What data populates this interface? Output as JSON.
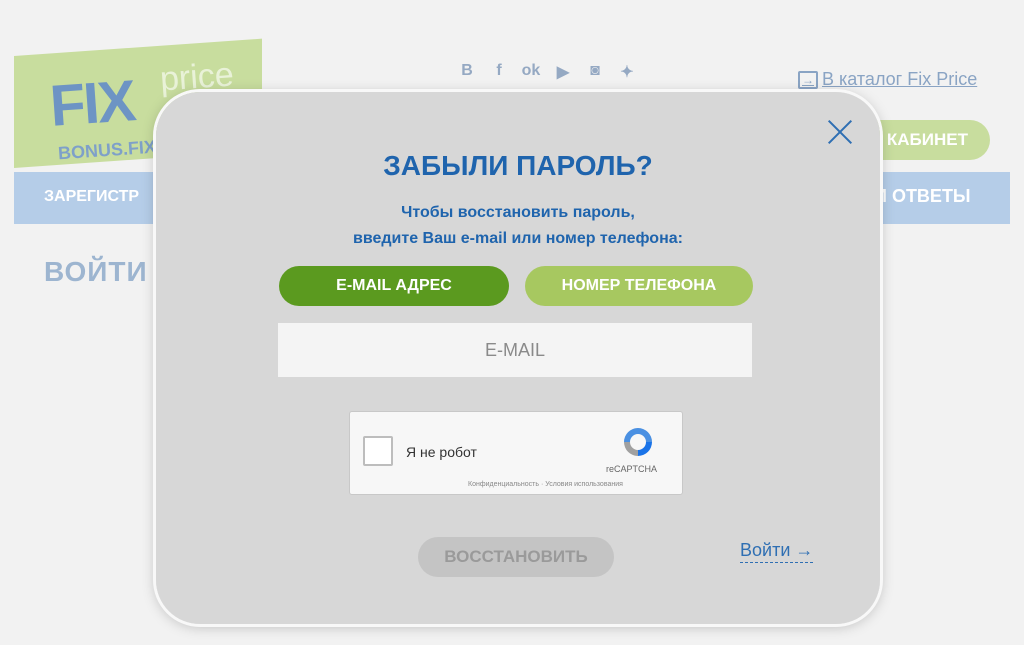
{
  "background": {
    "logo": {
      "main": "FIX",
      "secondary": "price",
      "sub": "BONUS.FIX"
    },
    "socials": [
      {
        "label": "В",
        "icon": "vk-icon"
      },
      {
        "label": "f",
        "icon": "facebook-icon"
      },
      {
        "label": "ok",
        "icon": "odnoklassniki-icon"
      },
      {
        "label": "▶",
        "icon": "youtube-icon"
      },
      {
        "label": "◙",
        "icon": "instagram-icon"
      },
      {
        "label": "✦",
        "icon": "twitter-icon"
      }
    ],
    "catalog_link": "В каталог Fix Price",
    "cabinet_button": "КАБИНЕТ",
    "nav_left": "ЗАРЕГИСТР",
    "nav_right": "И ОТВЕТЫ",
    "login_heading": "ВОЙТИ"
  },
  "modal": {
    "title": "ЗАБЫЛИ ПАРОЛЬ?",
    "subtitle_line1": "Чтобы восстановить пароль,",
    "subtitle_line2": "введите Ваш e-mail или номер телефона:",
    "tabs": [
      {
        "label": "E-MAIL АДРЕС",
        "active": true
      },
      {
        "label": "НОМЕР ТЕЛЕФОНА",
        "active": false
      }
    ],
    "email_input": {
      "placeholder": "E-MAIL",
      "value": ""
    },
    "captcha": {
      "label": "Я не робот",
      "brand": "reCAPTCHA",
      "terms": "Конфиденциальность · Условия использования"
    },
    "restore_button": "ВОССТАНОВИТЬ",
    "login_link": "Войти →"
  },
  "colors": {
    "accent_blue": "#1f64ad",
    "active_tab": "#5b9a1f",
    "inactive_tab": "#a7c860",
    "modal_bg": "#d7d7d7"
  }
}
